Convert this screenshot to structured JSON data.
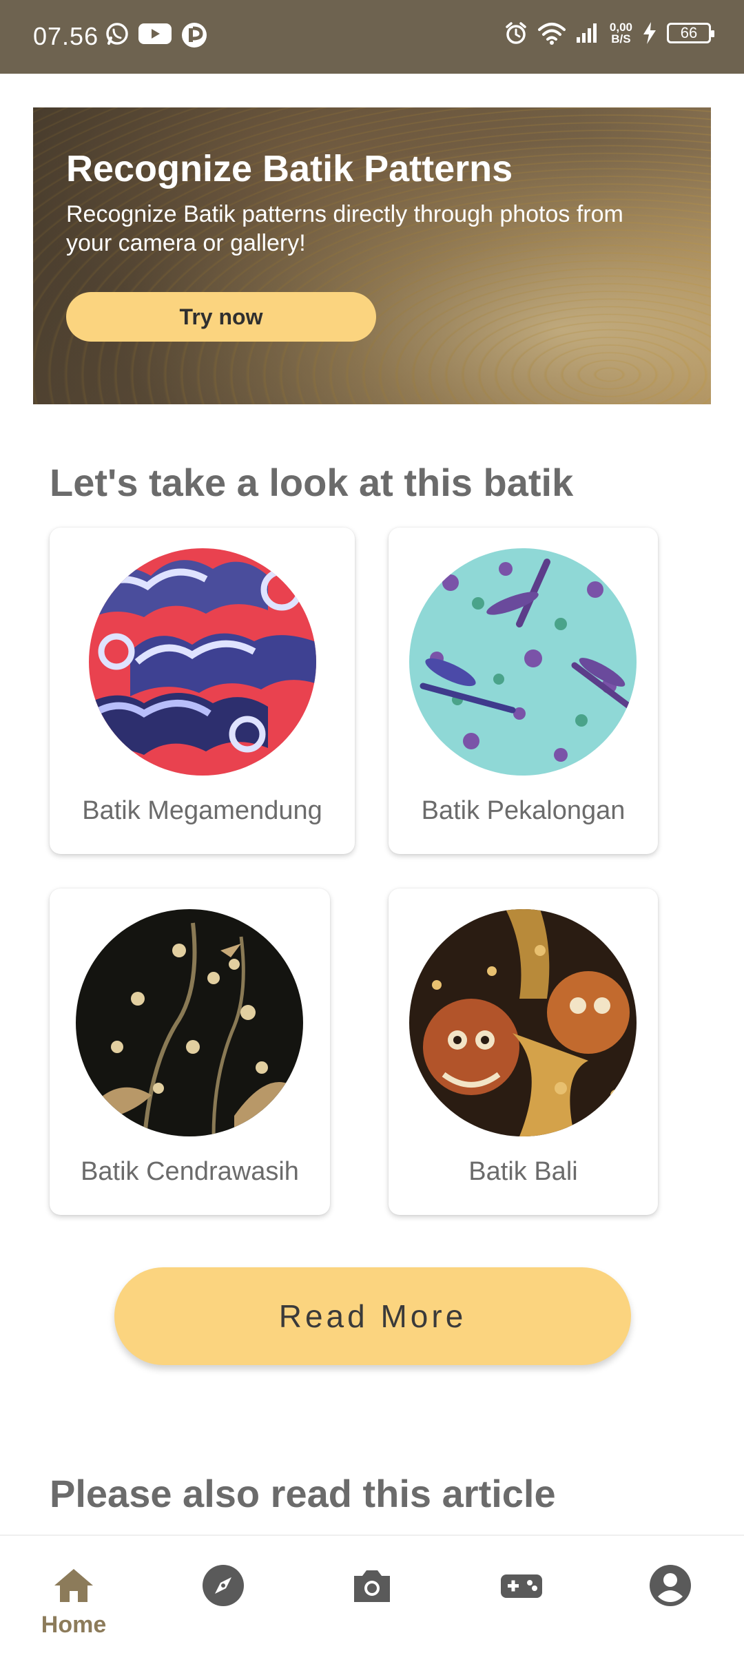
{
  "status_bar": {
    "time": "07.56",
    "speed_top": "0,00",
    "speed_bottom": "B/S",
    "battery": "66"
  },
  "hero": {
    "title": "Recognize Batik Patterns",
    "subtitle": "Recognize Batik patterns directly through photos from your camera or gallery!",
    "button_label": "Try now"
  },
  "batik_section": {
    "title": "Let's take a look at this batik",
    "items": [
      {
        "name": "Batik Megamendung",
        "image": "megamendung-pattern"
      },
      {
        "name": "Batik Pekalongan",
        "image": "pekalongan-pattern"
      },
      {
        "name": "Batik Cendrawasih",
        "image": "cendrawasih-pattern"
      },
      {
        "name": "Batik Bali",
        "image": "bali-pattern"
      }
    ],
    "read_more_label": "Read More"
  },
  "article_section": {
    "title": "Please also read this article"
  },
  "bottom_nav": {
    "items": [
      {
        "label": "Home",
        "icon": "home-icon",
        "active": true
      },
      {
        "label": "",
        "icon": "explore-icon",
        "active": false
      },
      {
        "label": "",
        "icon": "camera-icon",
        "active": false
      },
      {
        "label": "",
        "icon": "gamepad-icon",
        "active": false
      },
      {
        "label": "",
        "icon": "account-icon",
        "active": false
      }
    ],
    "active_color": "#8c7b5a",
    "inactive_color": "#5a5a5a"
  },
  "colors": {
    "status_bar": "#6e6350",
    "accent": "#fbd47f",
    "heading_text": "#6b6b6b"
  }
}
